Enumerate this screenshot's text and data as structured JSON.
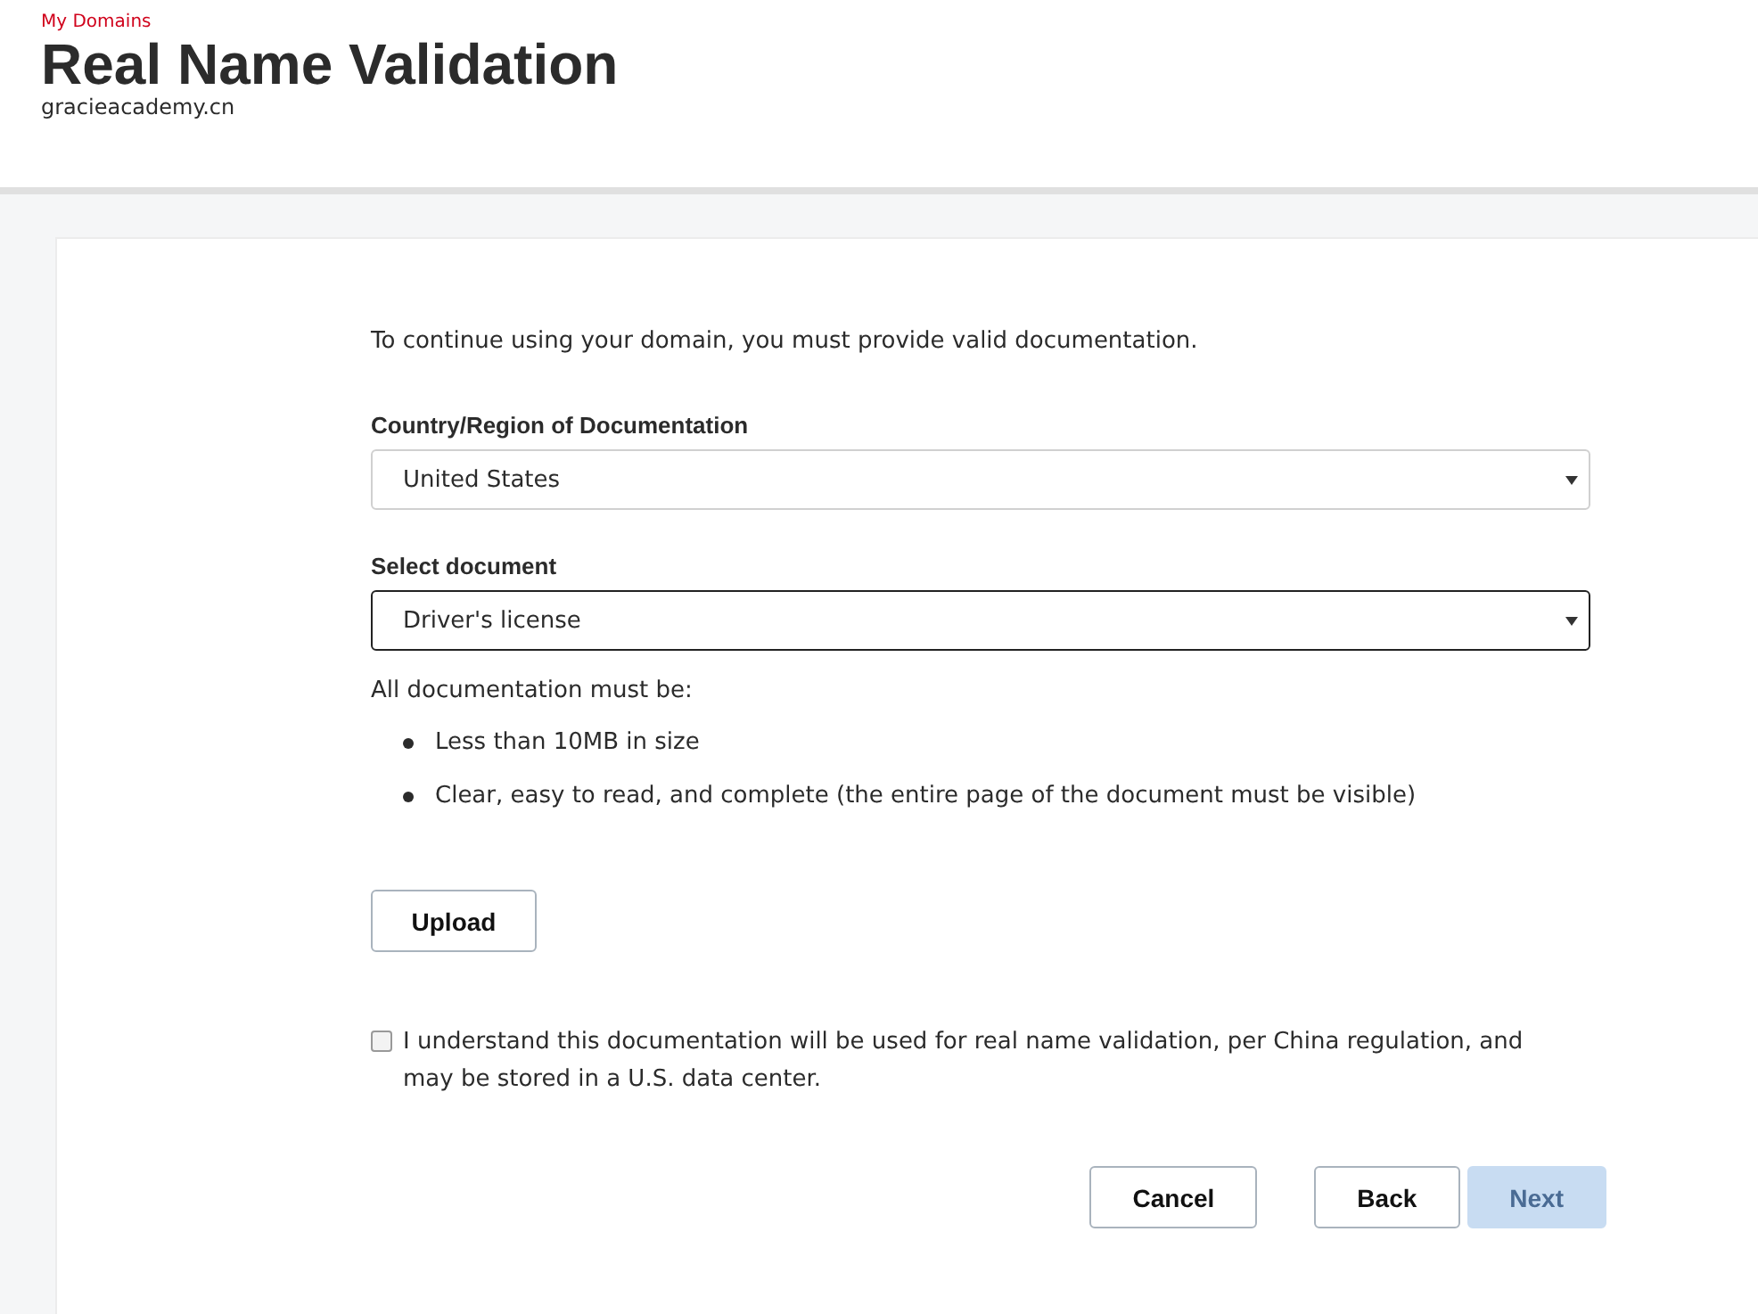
{
  "breadcrumb": "My Domains",
  "header": {
    "title": "Real Name Validation",
    "subtitle": "gracieacademy.cn"
  },
  "intro": "To continue using your domain, you must provide valid documentation.",
  "selects": [
    {
      "label": "Country/Region of Documentation",
      "value": "United States",
      "focused": false
    },
    {
      "label": "Select document",
      "value": "Driver's license",
      "focused": true
    }
  ],
  "requirements": {
    "heading": "All documentation must be:",
    "items": [
      "Less than 10MB in size",
      "Clear, easy to read, and complete (the entire page of the document must be visible)"
    ]
  },
  "upload_button": "Upload",
  "consent": {
    "checked": false,
    "text": "I understand this documentation will be used for real name validation, per China regulation, and may be stored in a U.S. data center."
  },
  "buttons": [
    {
      "label": "Cancel",
      "disabled": false
    },
    {
      "label": "Back",
      "disabled": false
    },
    {
      "label": "Next",
      "disabled": true
    }
  ]
}
